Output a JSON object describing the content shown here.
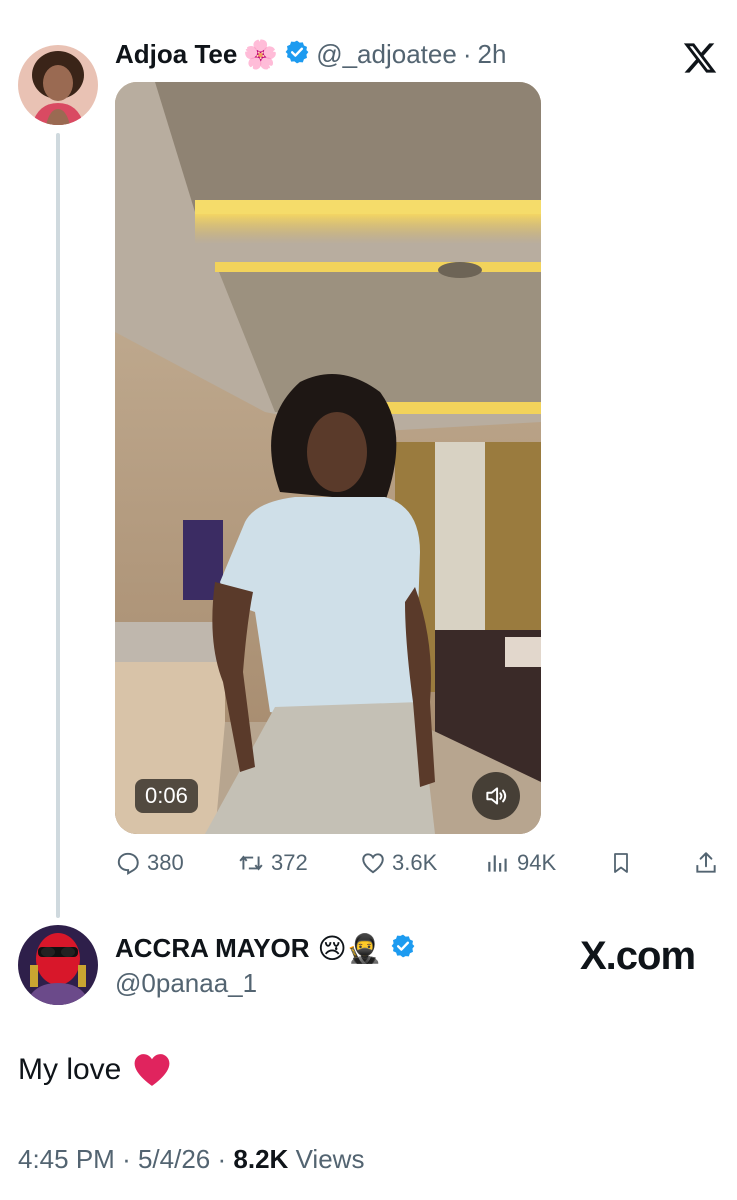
{
  "colors": {
    "accent_blue": "#1d9bf0",
    "text_primary": "#0f1419",
    "text_secondary": "#536471",
    "heart_red": "#e0245e"
  },
  "post": {
    "author_name": "Adjoa Tee",
    "author_emoji": "🌸",
    "handle": "@_adjoatee",
    "separator": "·",
    "time_ago": "2h",
    "video": {
      "timestamp": "0:06",
      "muted_icon": "speaker-icon"
    },
    "stats": {
      "replies": "380",
      "reposts": "372",
      "likes": "3.6K",
      "views": "94K"
    }
  },
  "reply": {
    "author_name": "ACCRA MAYOR",
    "author_emojis": "😢🥷",
    "handle": "@0panaa_1",
    "text": "My love",
    "text_emoji": "❤️",
    "time": "4:45 PM",
    "date": "5/4/26",
    "separator": "·",
    "views_count": "8.2K",
    "views_label": "Views"
  },
  "watermark": {
    "logo_icon": "x-logo-icon",
    "site_text": "X.com"
  }
}
